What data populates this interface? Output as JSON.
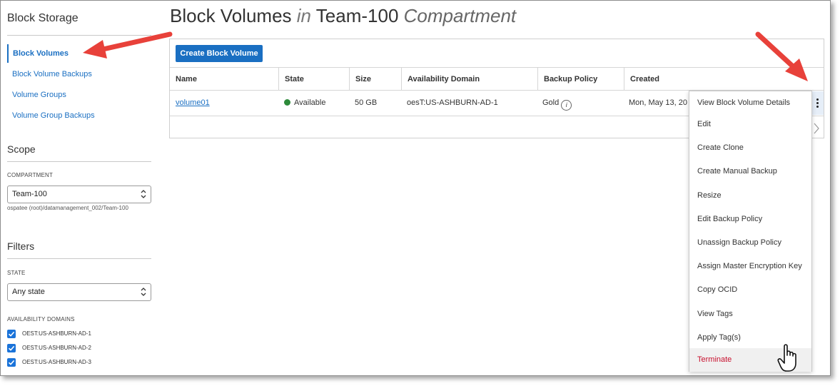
{
  "sidebar": {
    "title": "Block Storage",
    "nav_items": [
      {
        "label": "Block Volumes",
        "active": true
      },
      {
        "label": "Block Volume Backups",
        "active": false
      },
      {
        "label": "Volume Groups",
        "active": false
      },
      {
        "label": "Volume Group Backups",
        "active": false
      }
    ],
    "scope_title": "Scope",
    "compartment_label": "COMPARTMENT",
    "compartment_value": "Team-100",
    "compartment_path": "ospatee (root)/datamanagement_002/Team-100",
    "filters_title": "Filters",
    "state_label": "STATE",
    "state_value": "Any state",
    "ad_label": "AVAILABILITY DOMAINS",
    "ad_items": [
      "OEST:US-ASHBURN-AD-1",
      "OEST:US-ASHBURN-AD-2",
      "OEST:US-ASHBURN-AD-3"
    ]
  },
  "page": {
    "title_main": "Block Volumes",
    "title_in": "in",
    "title_compartment": "Team-100",
    "title_suffix": "Compartment"
  },
  "toolbar": {
    "create_label": "Create Block Volume"
  },
  "table": {
    "columns": [
      "Name",
      "State",
      "Size",
      "Availability Domain",
      "Backup Policy",
      "Created"
    ],
    "rows": [
      {
        "name": "volume01",
        "state": "Available",
        "size": "50 GB",
        "ad": "oesT:US-ASHBURN-AD-1",
        "backup_policy": "Gold",
        "created": "Mon, May 13, 20"
      }
    ]
  },
  "context_menu": {
    "items": [
      "View Block Volume Details",
      "Edit",
      "Create Clone",
      "Create Manual Backup",
      "Resize",
      "Edit Backup Policy",
      "Unassign Backup Policy",
      "Assign Master Encryption Key",
      "Copy OCID",
      "View Tags",
      "Apply Tag(s)",
      "Terminate"
    ]
  },
  "colors": {
    "accent": "#1a6fc2",
    "status_available": "#2d8a3a",
    "danger": "#c8102e",
    "annotation_arrow": "#e8413a"
  },
  "icons": [
    "info-icon",
    "kebab-menu-icon",
    "chevron-right-icon",
    "select-caret-icon",
    "checkbox-checked-icon",
    "hand-cursor-icon",
    "annotation-arrow"
  ]
}
